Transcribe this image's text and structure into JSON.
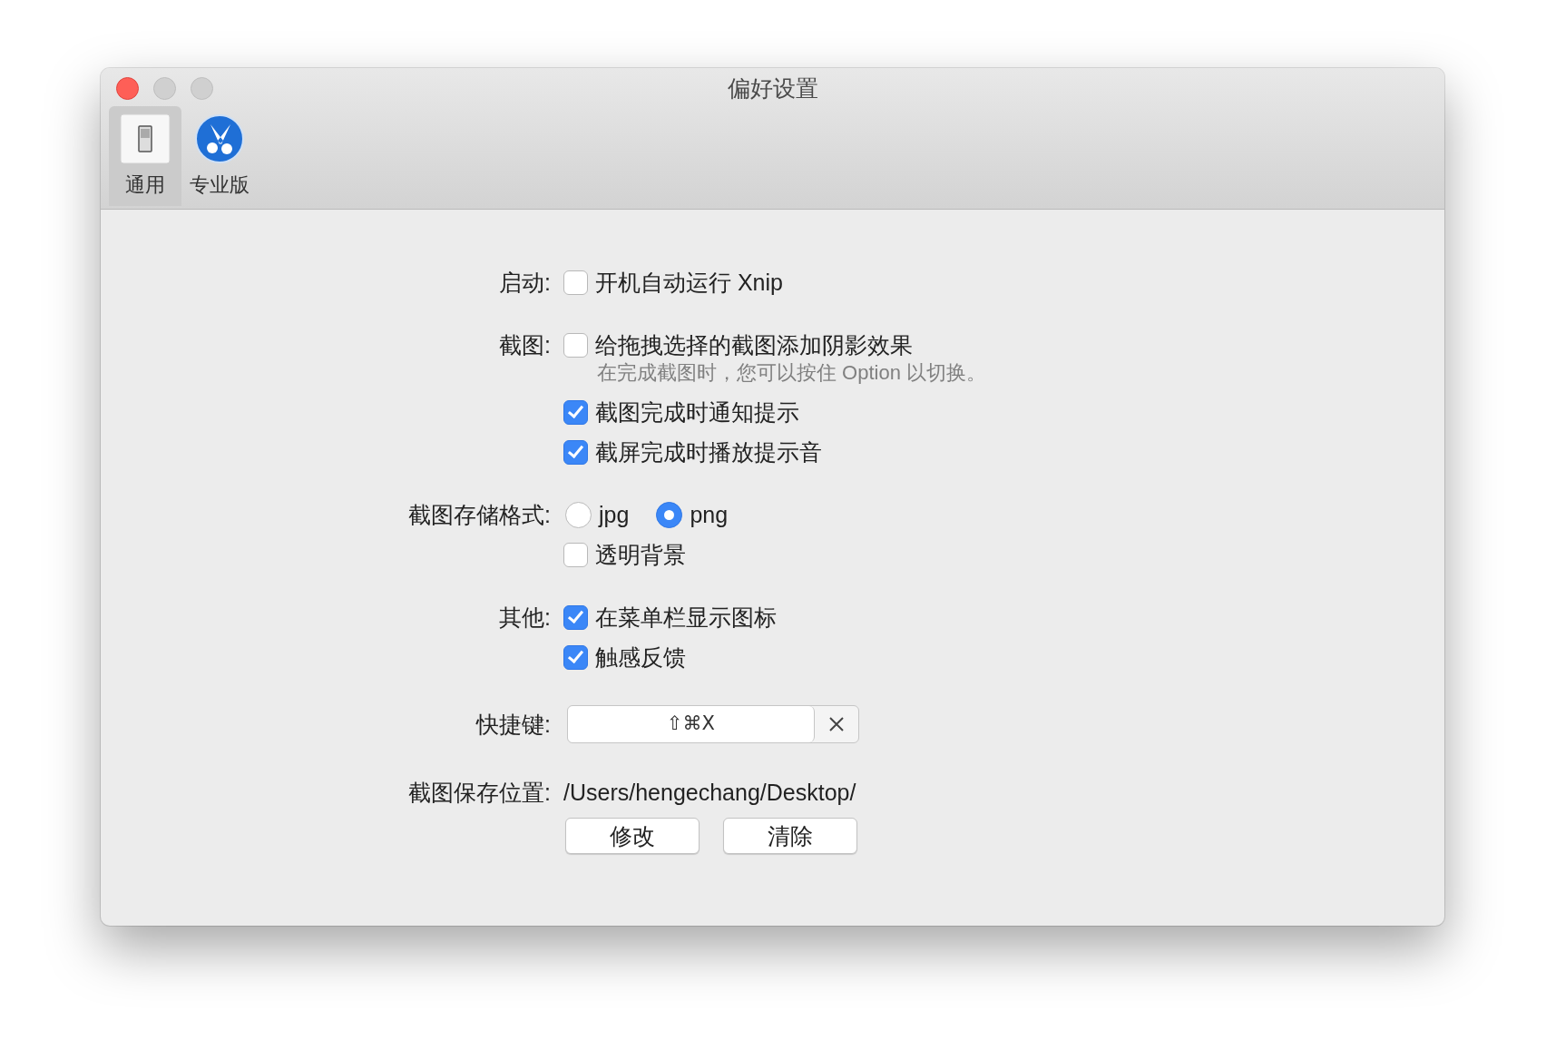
{
  "window": {
    "title": "偏好设置"
  },
  "toolbar": {
    "tabs": [
      {
        "label": "通用",
        "selected": true
      },
      {
        "label": "专业版",
        "selected": false
      }
    ]
  },
  "sections": [
    {
      "label": "启动:",
      "items": [
        {
          "kind": "checkbox",
          "label": "开机自动运行 Xnip",
          "checked": false
        }
      ]
    },
    {
      "label": "截图:",
      "items": [
        {
          "kind": "checkbox",
          "label": "给拖拽选择的截图添加阴影效果",
          "checked": false,
          "hint": "在完成截图时，您可以按住 Option 以切换。"
        },
        {
          "kind": "checkbox",
          "label": "截图完成时通知提示",
          "checked": true
        },
        {
          "kind": "checkbox",
          "label": "截屏完成时播放提示音",
          "checked": true
        }
      ]
    },
    {
      "label": "截图存储格式:",
      "items": [
        {
          "kind": "radio-group",
          "options": [
            {
              "label": "jpg",
              "selected": false
            },
            {
              "label": "png",
              "selected": true
            }
          ]
        },
        {
          "kind": "checkbox",
          "label": "透明背景",
          "checked": false
        }
      ]
    },
    {
      "label": "其他:",
      "items": [
        {
          "kind": "checkbox",
          "label": "在菜单栏显示图标",
          "checked": true
        },
        {
          "kind": "checkbox",
          "label": "触感反馈",
          "checked": true
        }
      ]
    },
    {
      "label": "快捷键:",
      "items": [
        {
          "kind": "shortcut",
          "value": "⇧⌘X"
        }
      ]
    },
    {
      "label": "截图保存位置:",
      "items": [
        {
          "kind": "path",
          "text": "/Users/hengechang/Desktop/"
        },
        {
          "kind": "buttons",
          "buttons": [
            "修改",
            "清除"
          ]
        }
      ]
    }
  ]
}
